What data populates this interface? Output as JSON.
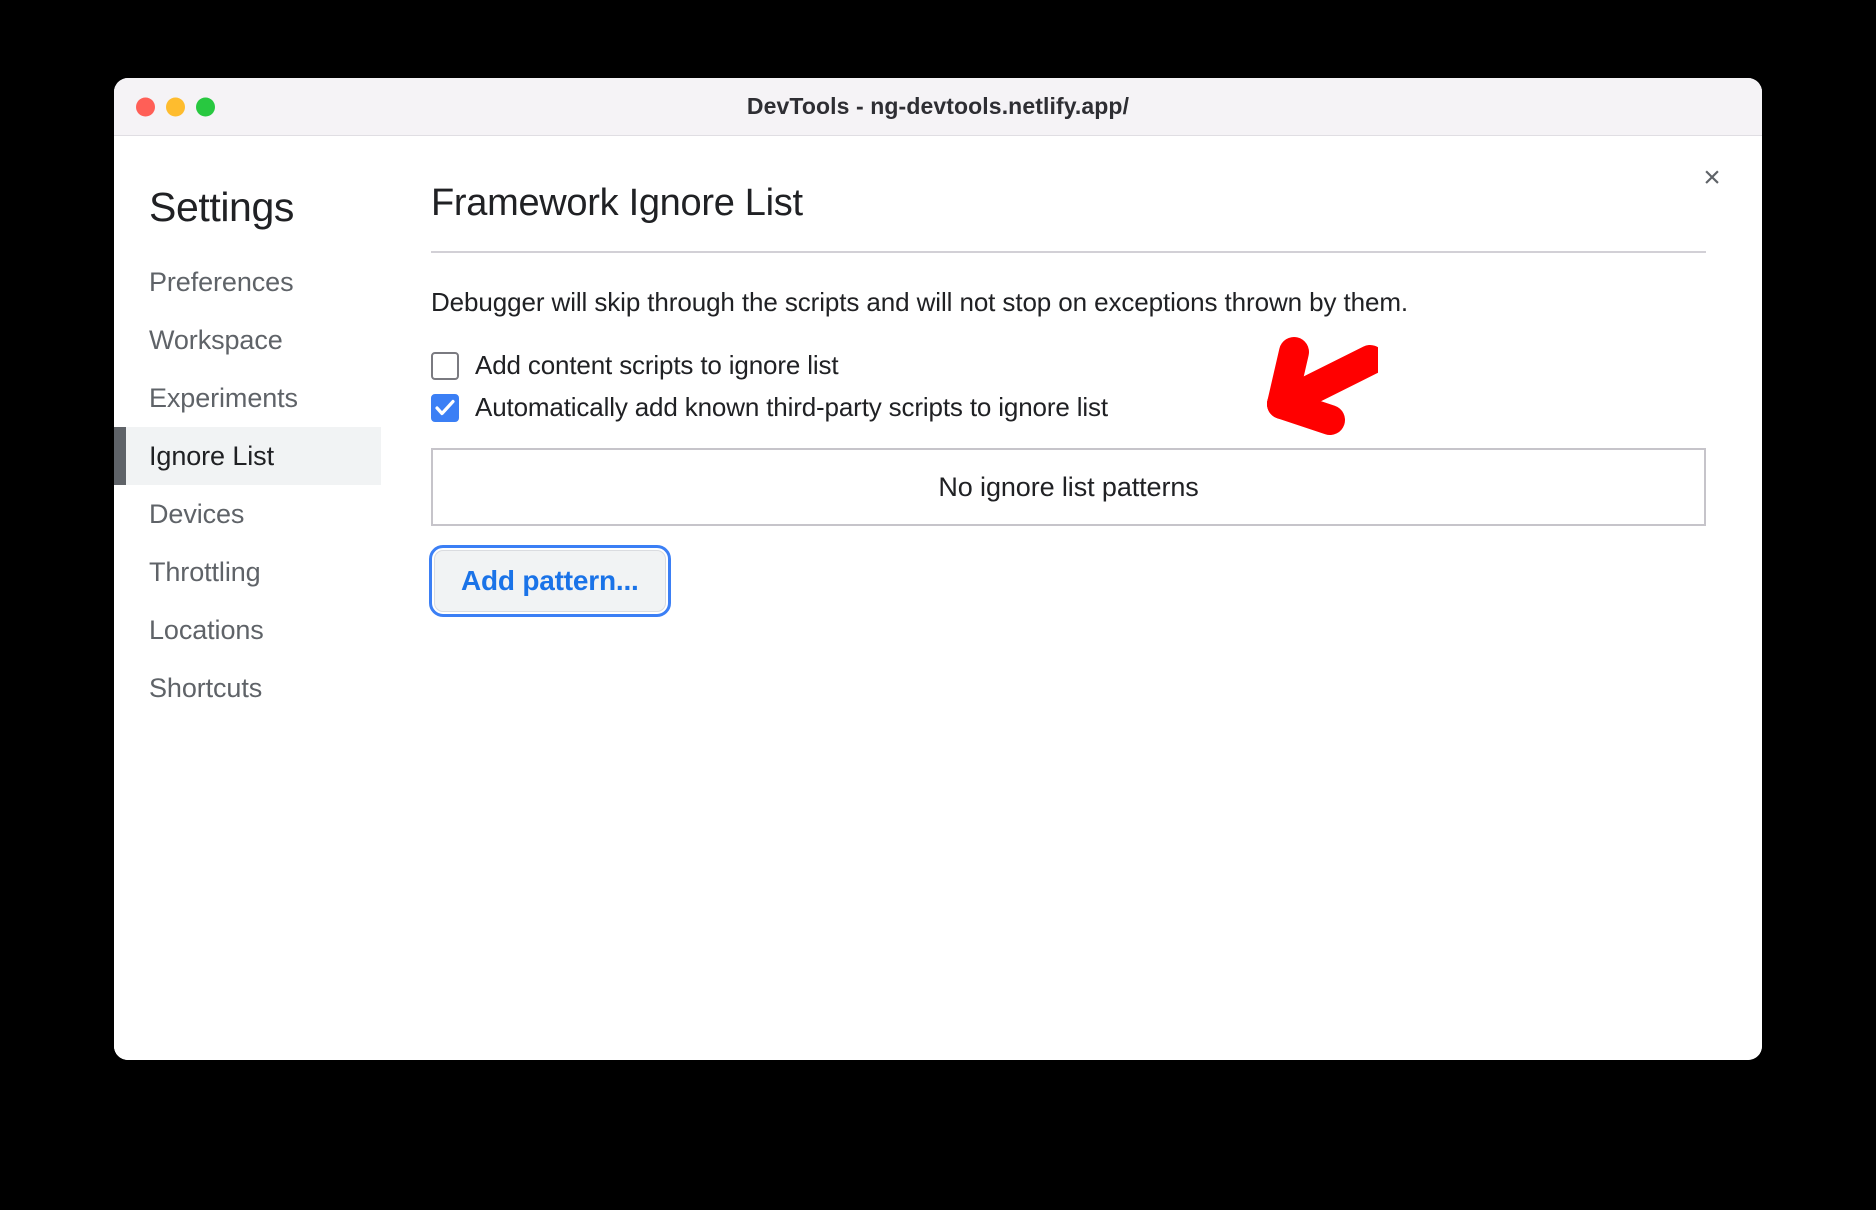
{
  "window": {
    "title": "DevTools - ng-devtools.netlify.app/",
    "traffic_lights": [
      "close-red",
      "minimize-yellow",
      "maximize-green"
    ],
    "close_icon": "×"
  },
  "sidebar": {
    "heading": "Settings",
    "items": [
      {
        "label": "Preferences",
        "selected": false
      },
      {
        "label": "Workspace",
        "selected": false
      },
      {
        "label": "Experiments",
        "selected": false
      },
      {
        "label": "Ignore List",
        "selected": true
      },
      {
        "label": "Devices",
        "selected": false
      },
      {
        "label": "Throttling",
        "selected": false
      },
      {
        "label": "Locations",
        "selected": false
      },
      {
        "label": "Shortcuts",
        "selected": false
      }
    ]
  },
  "panel": {
    "title": "Framework Ignore List",
    "description": "Debugger will skip through the scripts and will not stop on exceptions thrown by them.",
    "checkboxes": [
      {
        "label": "Add content scripts to ignore list",
        "checked": false
      },
      {
        "label": "Automatically add known third-party scripts to ignore list",
        "checked": true
      }
    ],
    "patterns_empty_text": "No ignore list patterns",
    "add_pattern_label": "Add pattern..."
  },
  "annotation": {
    "arrow_color": "#FF0000",
    "arrow_direction": "down-left",
    "points_at": "Automatically add known third-party scripts to ignore list"
  },
  "colors": {
    "accent_blue": "#1a73e8",
    "checkbox_blue": "#3b7ff5",
    "selected_bg": "#f1f3f4",
    "selected_bar": "#5f6368",
    "titlebar_bg": "#f5f3f6",
    "annotation_red": "#FF0000"
  }
}
